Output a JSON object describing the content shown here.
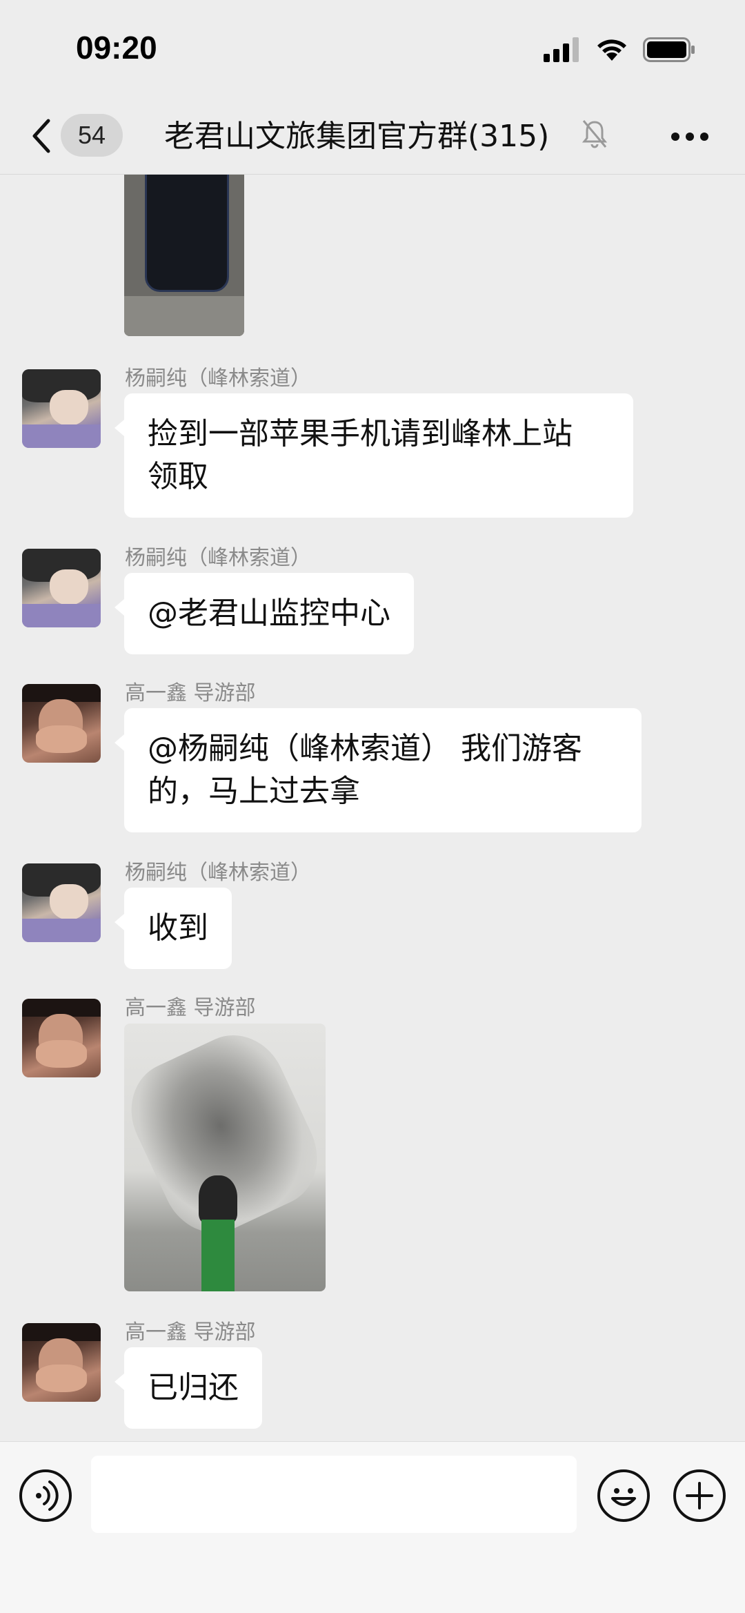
{
  "status_bar": {
    "time": "09:20"
  },
  "nav": {
    "unread_badge": "54",
    "title": "老君山文旅集团官方群(315)"
  },
  "messages": [
    {
      "sender": "杨嗣纯（峰林索道）",
      "text_line1": "捡到一部苹果手机请到峰林上站",
      "text_line2": "领取"
    },
    {
      "sender": "杨嗣纯（峰林索道）",
      "text": "@老君山监控中心"
    },
    {
      "sender": "高一鑫  导游部",
      "text_line1": "@杨嗣纯（峰林索道） 我们游客",
      "text_line2": "的，马上过去拿"
    },
    {
      "sender": "杨嗣纯（峰林索道）",
      "text": "收到"
    },
    {
      "sender": "高一鑫  导游部"
    },
    {
      "sender": "高一鑫  导游部",
      "text": "已归还"
    }
  ],
  "input": {
    "value": "",
    "placeholder": ""
  },
  "icons": {
    "back": "chevron-left-icon",
    "mute": "bell-off-icon",
    "more": "more-icon",
    "voice": "voice-icon",
    "emoji": "emoji-icon",
    "plus": "plus-icon"
  }
}
